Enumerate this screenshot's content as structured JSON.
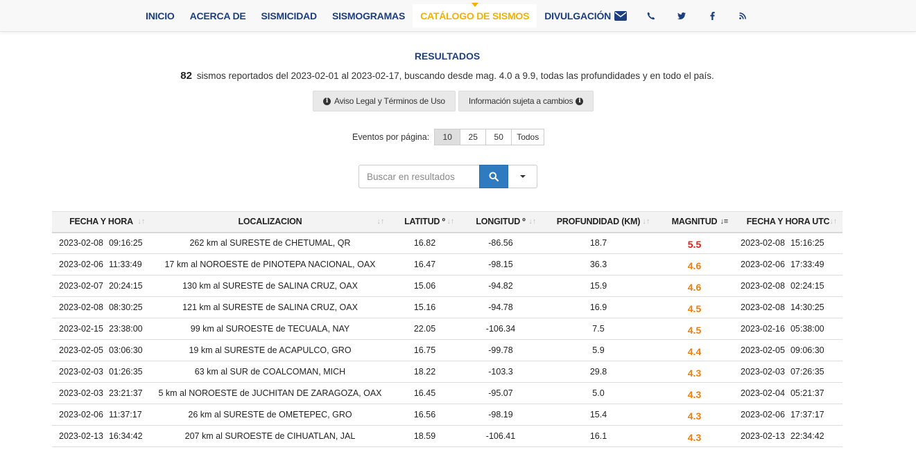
{
  "nav": {
    "items": [
      {
        "label": "INICIO",
        "name": "nav-item-inicio",
        "active": false
      },
      {
        "label": "ACERCA DE",
        "name": "nav-item-acerca-de",
        "active": false
      },
      {
        "label": "SISMICIDAD",
        "name": "nav-item-sismicidad",
        "active": false
      },
      {
        "label": "SISMOGRAMAS",
        "name": "nav-item-sismogramas",
        "active": false
      },
      {
        "label": "CATÁLOGO DE SISMOS",
        "name": "nav-item-catalogo-de-sismos",
        "active": true
      },
      {
        "label": "DIVULGACIÓN",
        "name": "nav-item-divulgacion",
        "active": false
      }
    ],
    "icons": [
      "envelope-icon",
      "phone-icon",
      "twitter-icon",
      "facebook-icon",
      "rss-icon"
    ],
    "colors": {
      "link": "#1d3f80",
      "active": "#f3b200"
    }
  },
  "results": {
    "title": "RESULTADOS",
    "count": "82",
    "summary": "sismos reportados del 2023-02-01 al 2023-02-17, buscando desde mag. 4.0 a 9.9, todas las profundidades y en todo el país."
  },
  "buttons": {
    "legal": "Aviso Legal y Términos de Uso",
    "info": "Información sujeta a cambios"
  },
  "pager": {
    "label": "Eventos por página:",
    "options": [
      "10",
      "25",
      "50",
      "Todos"
    ],
    "selected": "10"
  },
  "search": {
    "placeholder": "Buscar en resultados"
  },
  "table": {
    "headers": [
      "FECHA Y HORA",
      "LOCALIZACION",
      "LATITUD º",
      "LONGITUD º",
      "PROFUNDIDAD (KM)",
      "MAGNITUD",
      "FECHA Y HORA UTC"
    ],
    "sorted_column": "MAGNITUD",
    "mag_colors": {
      "high": "#d9201e",
      "mid": "#f07d0a"
    },
    "rows": [
      {
        "date": "2023-02-08",
        "time": "09:16:25",
        "loc": "262 km al SURESTE de CHETUMAL, QR",
        "lat": "16.82",
        "lon": "-86.56",
        "depth": "18.7",
        "mag": "5.5",
        "level": "high",
        "utc_date": "2023-02-08",
        "utc_time": "15:16:25"
      },
      {
        "date": "2023-02-06",
        "time": "11:33:49",
        "loc": "17 km al NOROESTE de PINOTEPA NACIONAL, OAX",
        "lat": "16.47",
        "lon": "-98.15",
        "depth": "36.3",
        "mag": "4.6",
        "level": "mid",
        "utc_date": "2023-02-06",
        "utc_time": "17:33:49"
      },
      {
        "date": "2023-02-07",
        "time": "20:24:15",
        "loc": "130 km al SURESTE de SALINA CRUZ, OAX",
        "lat": "15.06",
        "lon": "-94.82",
        "depth": "15.9",
        "mag": "4.6",
        "level": "mid",
        "utc_date": "2023-02-08",
        "utc_time": "02:24:15"
      },
      {
        "date": "2023-02-08",
        "time": "08:30:25",
        "loc": "121 km al SURESTE de SALINA CRUZ, OAX",
        "lat": "15.16",
        "lon": "-94.78",
        "depth": "16.9",
        "mag": "4.5",
        "level": "mid",
        "utc_date": "2023-02-08",
        "utc_time": "14:30:25"
      },
      {
        "date": "2023-02-15",
        "time": "23:38:00",
        "loc": "99 km al SUROESTE de TECUALA, NAY",
        "lat": "22.05",
        "lon": "-106.34",
        "depth": "7.5",
        "mag": "4.5",
        "level": "mid",
        "utc_date": "2023-02-16",
        "utc_time": "05:38:00"
      },
      {
        "date": "2023-02-05",
        "time": "03:06:30",
        "loc": "19 km al SURESTE de ACAPULCO, GRO",
        "lat": "16.75",
        "lon": "-99.78",
        "depth": "5.9",
        "mag": "4.4",
        "level": "mid",
        "utc_date": "2023-02-05",
        "utc_time": "09:06:30"
      },
      {
        "date": "2023-02-03",
        "time": "01:26:35",
        "loc": "63 km al SUR de COALCOMAN, MICH",
        "lat": "18.22",
        "lon": "-103.3",
        "depth": "29.8",
        "mag": "4.3",
        "level": "mid",
        "utc_date": "2023-02-03",
        "utc_time": "07:26:35"
      },
      {
        "date": "2023-02-03",
        "time": "23:21:37",
        "loc": "5 km al NOROESTE de JUCHITAN DE ZARAGOZA, OAX",
        "lat": "16.45",
        "lon": "-95.07",
        "depth": "5.0",
        "mag": "4.3",
        "level": "mid",
        "utc_date": "2023-02-04",
        "utc_time": "05:21:37"
      },
      {
        "date": "2023-02-06",
        "time": "11:37:17",
        "loc": "26 km al SURESTE de OMETEPEC, GRO",
        "lat": "16.56",
        "lon": "-98.19",
        "depth": "15.4",
        "mag": "4.3",
        "level": "mid",
        "utc_date": "2023-02-06",
        "utc_time": "17:37:17"
      },
      {
        "date": "2023-02-13",
        "time": "16:34:42",
        "loc": "207 km al SUROESTE de CIHUATLAN, JAL",
        "lat": "18.59",
        "lon": "-106.41",
        "depth": "16.1",
        "mag": "4.3",
        "level": "mid",
        "utc_date": "2023-02-13",
        "utc_time": "22:34:42"
      }
    ]
  }
}
